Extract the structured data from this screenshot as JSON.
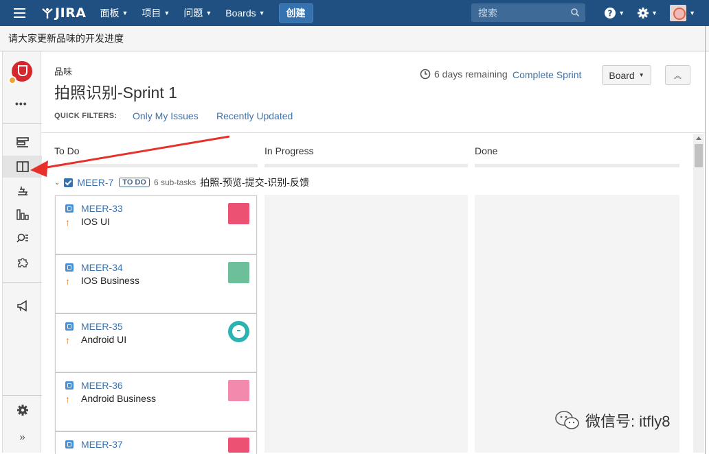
{
  "topnav": {
    "logo_text": "JIRA",
    "menus": [
      {
        "label": "面板"
      },
      {
        "label": "项目"
      },
      {
        "label": "问题"
      },
      {
        "label": "Boards"
      }
    ],
    "create_label": "创建",
    "search_placeholder": "搜索",
    "icons": [
      "menu-icon",
      "help-icon",
      "settings-icon",
      "user-avatar"
    ],
    "bg_color": "#205081"
  },
  "announcement": "请大家更新品味的开发进度",
  "sidebar": {
    "icons": [
      "backlog-icon",
      "active-sprints-icon",
      "releases-icon",
      "reports-icon",
      "issues-icon",
      "components-icon",
      "feedback-icon",
      "project-settings-icon",
      "expand-icon"
    ],
    "more_label": "•••"
  },
  "header": {
    "project_name": "品味",
    "sprint_title": "拍照识别-Sprint 1",
    "remaining": "6 days remaining",
    "complete_sprint": "Complete Sprint",
    "board_button": "Board",
    "quick_filters_label": "QUICK FILTERS:",
    "quick_filters": [
      "Only My Issues",
      "Recently Updated"
    ]
  },
  "columns": [
    "To Do",
    "In Progress",
    "Done"
  ],
  "swimlane": {
    "key": "MEER-7",
    "status": "TO DO",
    "subtasks": "6 sub-tasks",
    "summary": "拍照-预览-提交-识别-反馈"
  },
  "cards": [
    {
      "key": "MEER-33",
      "summary": "IOS UI",
      "avatar_color": "#ec5073"
    },
    {
      "key": "MEER-34",
      "summary": "IOS Business",
      "avatar_color": "#6dbf9a"
    },
    {
      "key": "MEER-35",
      "summary": "Android UI",
      "avatar_color": "#2bb3b1"
    },
    {
      "key": "MEER-36",
      "summary": "Android Business",
      "avatar_color": "#f28aad"
    },
    {
      "key": "MEER-37",
      "summary": "",
      "avatar_color": "#ec5073"
    }
  ],
  "watermark": "微信号: itfly8",
  "accent_color": "#3b73af",
  "annotation_arrow_color": "#e8302a"
}
